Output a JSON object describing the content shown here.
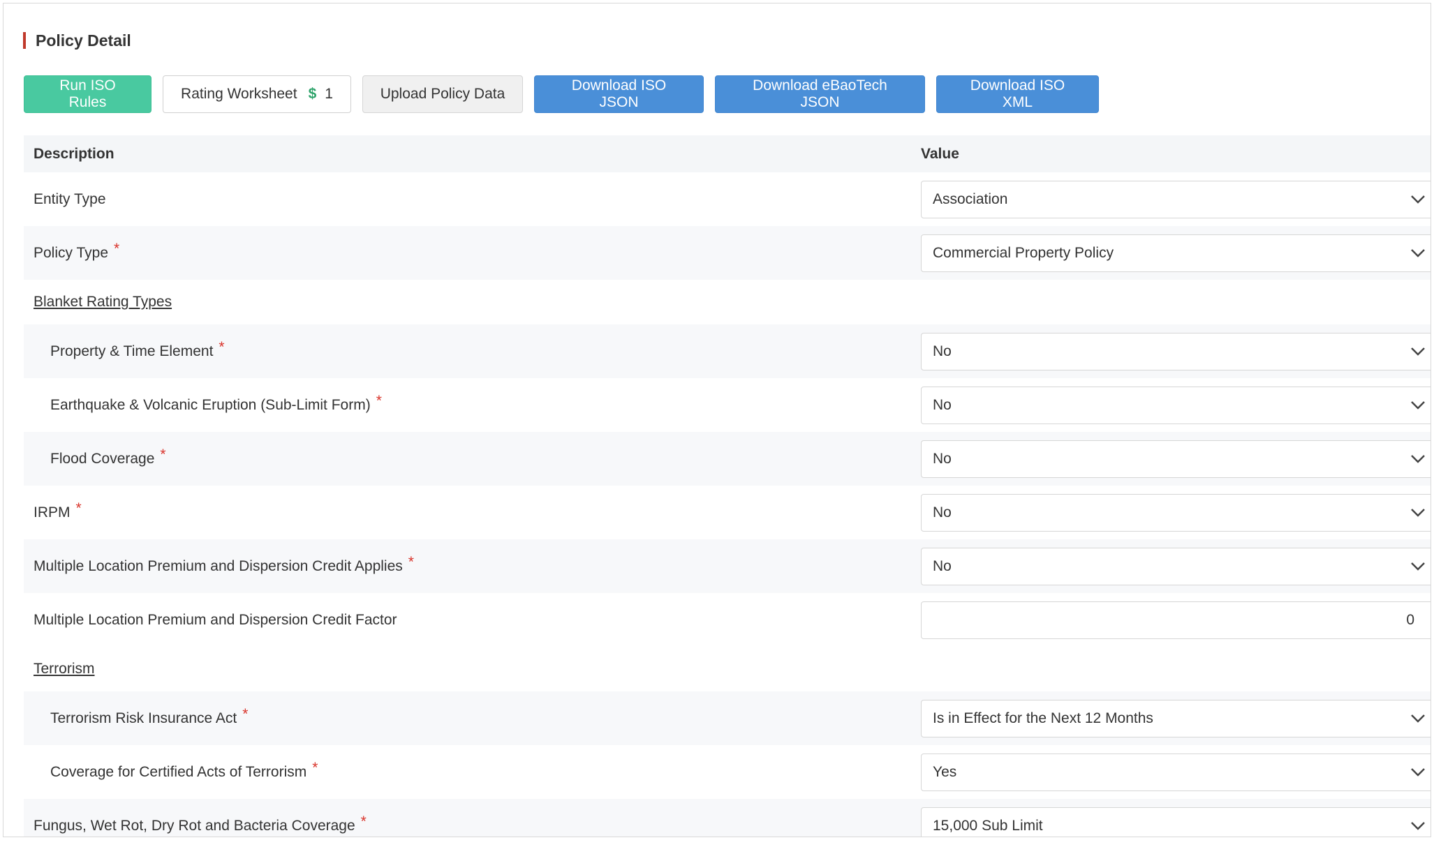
{
  "page": {
    "title": "Policy Detail"
  },
  "toolbar": {
    "run_iso": "Run ISO Rules",
    "rating_worksheet": "Rating Worksheet",
    "rating_symbol": "$",
    "rating_count": "1",
    "upload": "Upload Policy Data",
    "download_iso_json": "Download ISO JSON",
    "download_ebao_json": "Download eBaoTech JSON",
    "download_iso_xml": "Download ISO XML"
  },
  "table": {
    "headers": {
      "description": "Description",
      "value": "Value"
    },
    "rows": [
      {
        "label": "Entity Type",
        "value": "Association"
      },
      {
        "label": "Policy Type",
        "value": "Commercial Property Policy",
        "required": "*"
      },
      {
        "section": "Blanket Rating Types"
      },
      {
        "label": "Property & Time Element",
        "value": "No",
        "required": "*"
      },
      {
        "label": "Earthquake & Volcanic Eruption (Sub-Limit Form)",
        "value": "No",
        "required": "*"
      },
      {
        "label": "Flood Coverage",
        "value": "No",
        "required": "*"
      },
      {
        "label": "IRPM",
        "value": "No",
        "required": "*"
      },
      {
        "label": "Multiple Location Premium and Dispersion Credit Applies",
        "value": "No",
        "required": "*"
      },
      {
        "label": "Multiple Location Premium and Dispersion Credit Factor",
        "value": "0"
      },
      {
        "section": "Terrorism"
      },
      {
        "label": "Terrorism Risk Insurance Act",
        "value": "Is in Effect for the Next 12 Months",
        "required": "*"
      },
      {
        "label": "Coverage for Certified Acts of Terrorism",
        "value": "Yes",
        "required": "*"
      },
      {
        "label": "Fungus, Wet Rot, Dry Rot and Bacteria Coverage",
        "value": "15,000 Sub Limit",
        "required": "*"
      }
    ]
  },
  "colors": {
    "green": "#49c9a0",
    "blue": "#4a8fd8",
    "required": "#d9342b",
    "title_bar": "#c0392b"
  }
}
